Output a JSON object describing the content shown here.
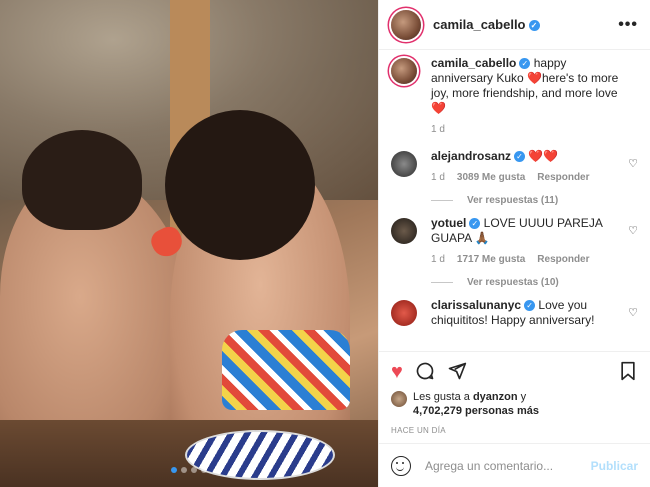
{
  "post": {
    "username": "camila_cabello",
    "verified_mark": "✓",
    "more_label": "•••"
  },
  "caption": {
    "username": "camila_cabello",
    "text": " happy anniversary Kuko ❤️here's to more joy, more friendship, and more love ❤️",
    "time": "1 d"
  },
  "comments": [
    {
      "username": "alejandrosanz",
      "text": " ❤️❤️",
      "time": "1 d",
      "likes": "3089 Me gusta",
      "reply_label": "Responder",
      "view_replies": "Ver respuestas (11)",
      "avatar_color": "#3d3d3d"
    },
    {
      "username": "yotuel",
      "text": " LOVE UUUU PAREJA GUAPA 🙏🏾",
      "time": "1 d",
      "likes": "1717 Me gusta",
      "reply_label": "Responder",
      "view_replies": "Ver respuestas (10)",
      "avatar_color": "#2a2a2a"
    },
    {
      "username": "clarissalunanyc",
      "text": " Love you chiquititos! Happy anniversary!",
      "avatar_color": "#c0392b"
    }
  ],
  "actions": {
    "like_icon": "heart-filled-icon",
    "comment_icon": "comment-icon",
    "share_icon": "share-icon",
    "save_icon": "bookmark-icon"
  },
  "likes": {
    "prefix": "Les gusta a ",
    "user": "dyanzon",
    "middle": " y",
    "count": "4,702,279 personas más"
  },
  "date": "HACE UN DÍA",
  "add_comment": {
    "placeholder": "Agrega un comentario...",
    "publish_label": "Publicar"
  },
  "carousel": {
    "total": 4,
    "active": 1
  },
  "colors": {
    "accent": "#3897f0",
    "heart": "#ed4956",
    "publish_disabled": "#b2dffc"
  }
}
